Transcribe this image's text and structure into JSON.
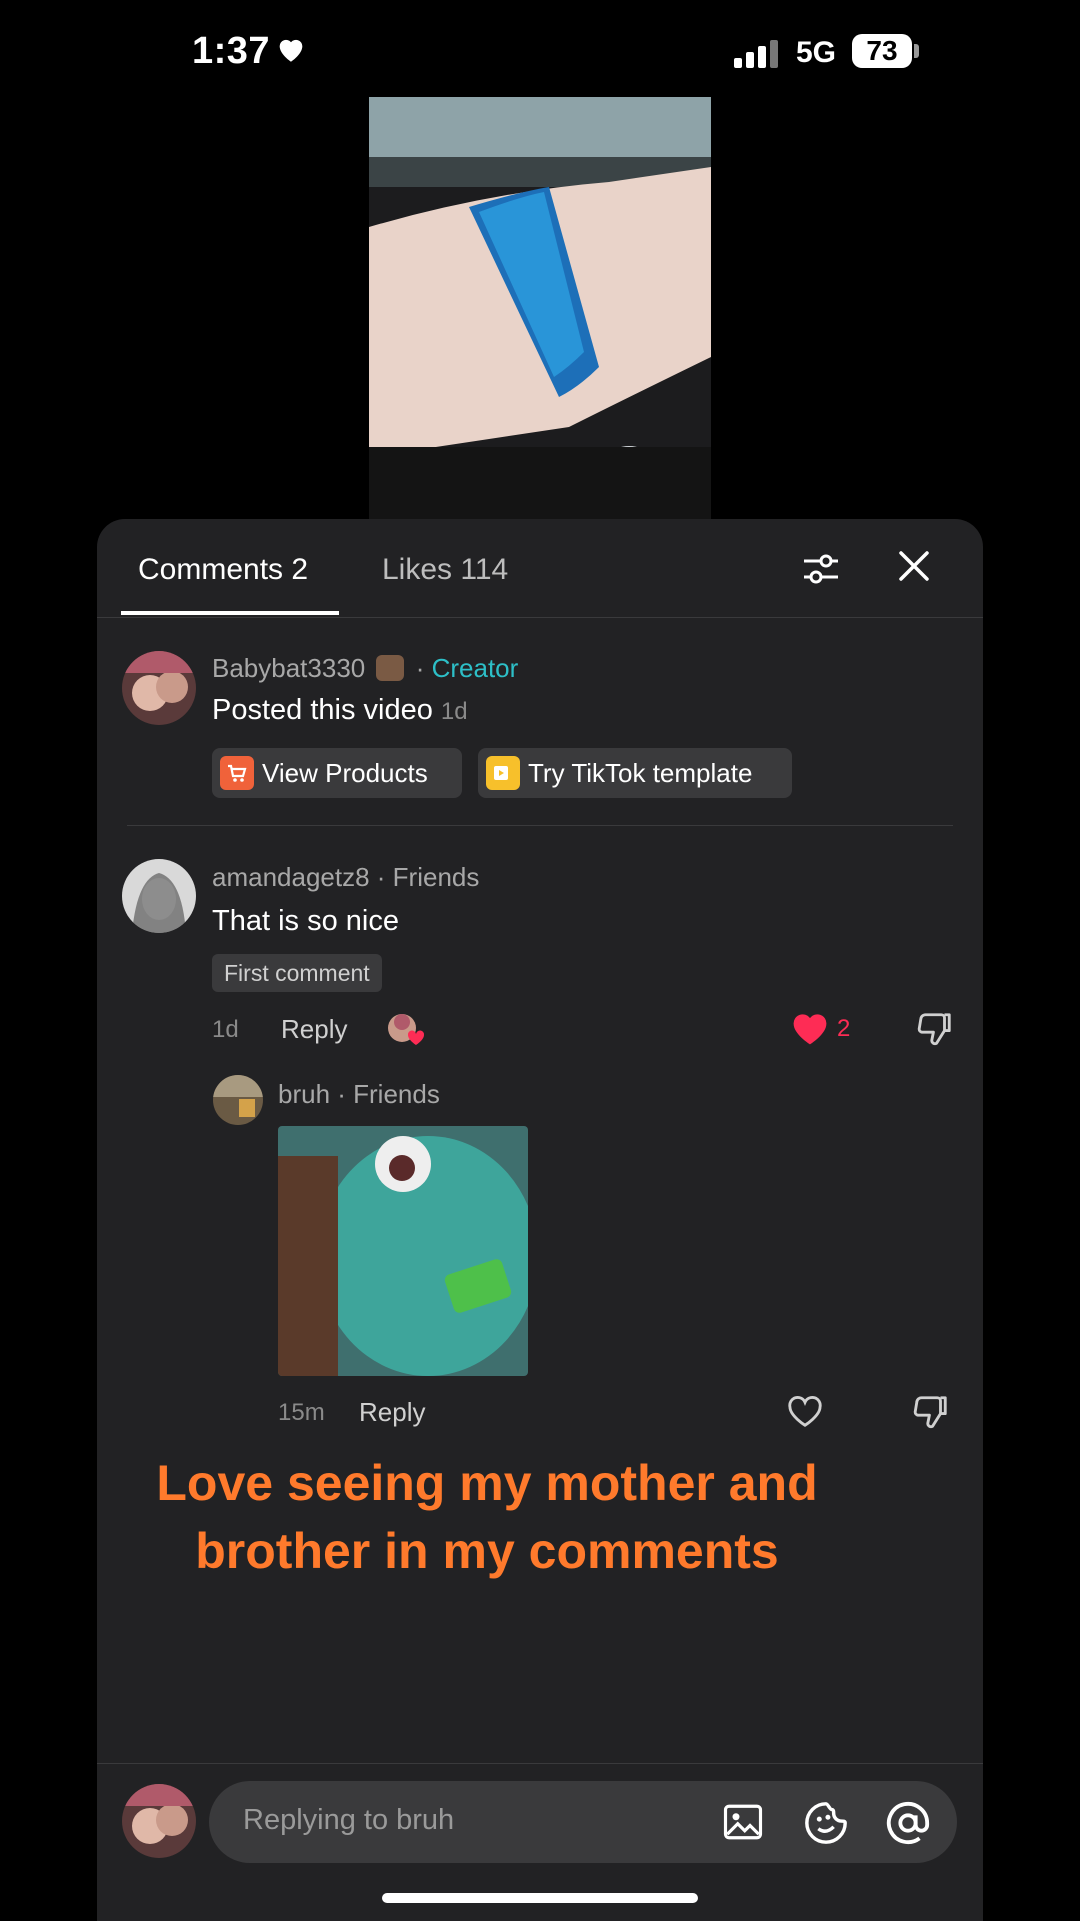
{
  "status_bar": {
    "time": "1:37",
    "network": "5G",
    "battery": "73"
  },
  "tabs": {
    "comments": "Comments 2",
    "likes": "Likes 114"
  },
  "creator_post": {
    "username": "Babybat3330",
    "separator": " · ",
    "role": "Creator",
    "text": "Posted this video",
    "time": "1d",
    "btn_products": "View Products",
    "btn_template": "Try TikTok template"
  },
  "comment1": {
    "username": "amandagetz8 · Friends",
    "text": "That is so nice",
    "badge": "First comment",
    "time": "1d",
    "reply": "Reply",
    "likes": "2"
  },
  "reply1": {
    "username": "bruh · Friends",
    "time": "15m",
    "reply": "Reply"
  },
  "caption": {
    "line1": "Love seeing my mother and",
    "line2": "brother in my comments"
  },
  "input": {
    "placeholder": "Replying to bruh"
  },
  "colors": {
    "accent_creator": "#2dbfc7",
    "like_red": "#fe2c55",
    "caption_orange": "#ff7a2c",
    "sheet_bg": "#222224"
  }
}
